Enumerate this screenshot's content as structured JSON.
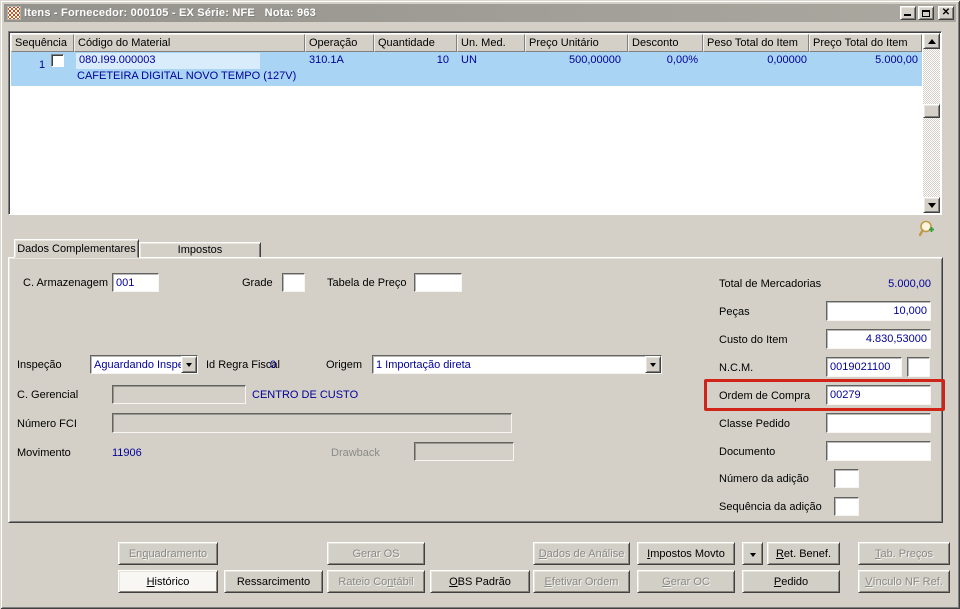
{
  "window": {
    "title": "Itens - Fornecedor: 000105 - EX Série: NFE   Nota: 963"
  },
  "table": {
    "columns": [
      "Sequência",
      "Código do Material",
      "Operação",
      "Quantidade",
      "Un. Med.",
      "Preço Unitário",
      "Desconto",
      "Peso Total do Item",
      "Preço Total do Item"
    ],
    "row": {
      "sequencia": "1",
      "codigo": "080.I99.000003",
      "descricao": "CAFETEIRA DIGITAL NOVO TEMPO (127V)",
      "operacao": "310.1A",
      "quantidade": "10",
      "un_med": "UN",
      "preco_unitario": "500,00000",
      "desconto": "0,00%",
      "peso_total": "0,00000",
      "preco_total": "5.000,00"
    }
  },
  "tabs": {
    "dados_complementares": "Dados Complementares",
    "impostos": "Impostos"
  },
  "form": {
    "c_armazenagem": {
      "label": "C. Armazenagem",
      "value": "001"
    },
    "grade": {
      "label": "Grade",
      "value": ""
    },
    "tabela_preco": {
      "label": "Tabela de Preço",
      "value": ""
    },
    "inspecao": {
      "label": "Inspeção",
      "value": "Aguardando Inspeção"
    },
    "id_regra_fiscal": {
      "label": "Id Regra Fiscal",
      "value": "0"
    },
    "origem": {
      "label": "Origem",
      "value": "1 Importação direta"
    },
    "c_gerencial": {
      "label": "C. Gerencial",
      "value": "",
      "caption": "CENTRO DE CUSTO"
    },
    "numero_fci": {
      "label": "Número FCI",
      "value": ""
    },
    "movimento": {
      "label": "Movimento",
      "value": "11906"
    },
    "drawback": {
      "label": "Drawback",
      "value": ""
    },
    "total_mercadorias": {
      "label": "Total de Mercadorias",
      "value": "5.000,00"
    },
    "pecas": {
      "label": "Peças",
      "value": "10,000"
    },
    "custo_item": {
      "label": "Custo do Item",
      "value": "4.830,53000"
    },
    "ncm": {
      "label": "N.C.M.",
      "value": "0019021100",
      "value2": ""
    },
    "ordem_compra": {
      "label": "Ordem de Compra",
      "value": "00279"
    },
    "classe_pedido": {
      "label": "Classe Pedido",
      "value": ""
    },
    "documento": {
      "label": "Documento",
      "value": ""
    },
    "numero_adicao": {
      "label": "Número da adição",
      "value": ""
    },
    "sequencia_adicao": {
      "label": "Sequência da adição",
      "value": ""
    }
  },
  "buttons": {
    "row1": [
      {
        "label": "Enquadramento",
        "accel": "q",
        "enabled": false
      },
      {
        "label": "Gerar OS",
        "accel": "",
        "enabled": false
      },
      {
        "label": "Dados de Análise",
        "accel": "D",
        "enabled": false
      },
      {
        "label": "Impostos Movto",
        "accel": "I",
        "enabled": true
      },
      {
        "label": "Ret. Benef.",
        "accel": "R",
        "enabled": true
      },
      {
        "label": "Tab. Preços",
        "accel": "T",
        "enabled": false
      }
    ],
    "row2": [
      {
        "label": "Histórico",
        "accel": "H",
        "enabled": true
      },
      {
        "label": "Ressarcimento",
        "accel": "",
        "enabled": true
      },
      {
        "label": "Rateio Contábil",
        "accel": "n",
        "enabled": false
      },
      {
        "label": "OBS Padrão",
        "accel": "O",
        "enabled": true
      },
      {
        "label": "Efetivar Ordem",
        "accel": "E",
        "enabled": false
      },
      {
        "label": "Gerar OC",
        "accel": "G",
        "enabled": false
      },
      {
        "label": "Pedido",
        "accel": "P",
        "enabled": true
      },
      {
        "label": "Vínculo NF Ref.",
        "accel": "V",
        "enabled": false
      }
    ]
  },
  "colors": {
    "row_selection": "#aad4f4",
    "value_text": "#000099",
    "highlight_box": "#d02418",
    "face": "#d4d0c8"
  }
}
